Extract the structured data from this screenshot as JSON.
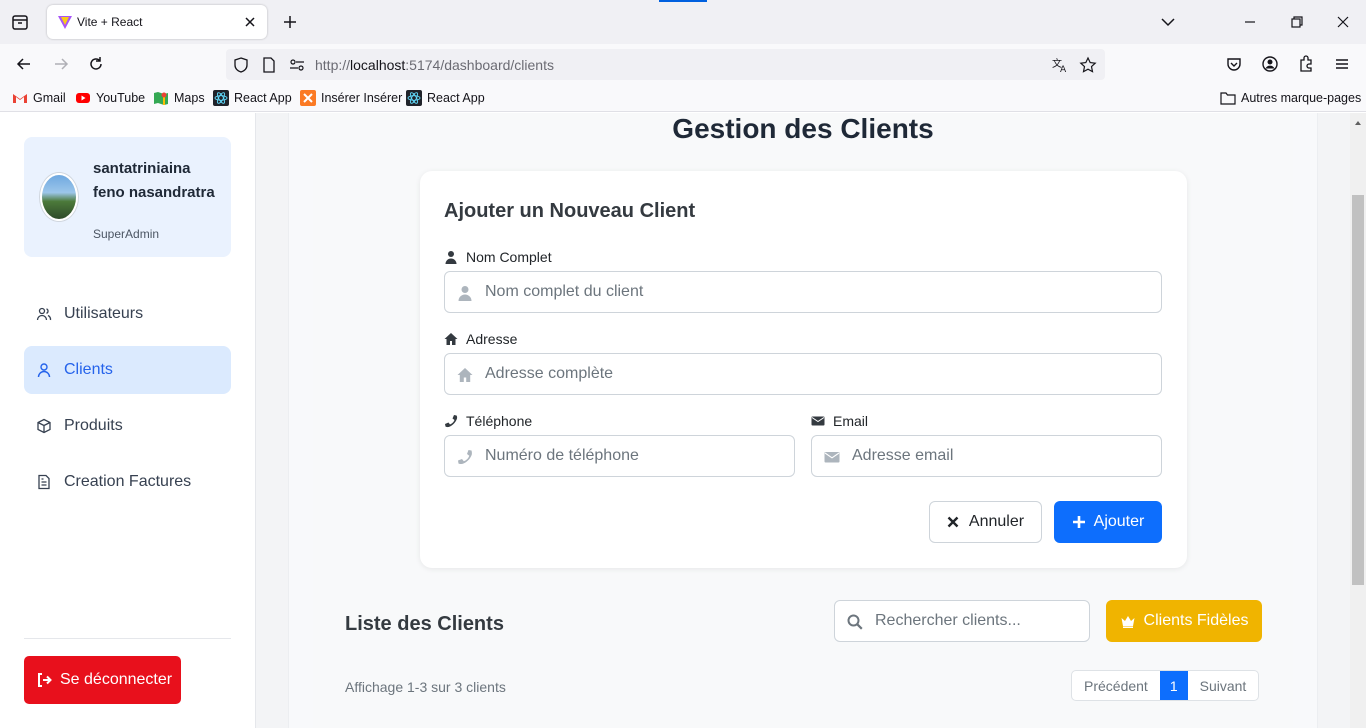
{
  "browser": {
    "tab_title": "Vite + React",
    "url_prefix": "http://",
    "url_host": "localhost",
    "url_rest": ":5174/dashboard/clients",
    "bookmarks": [
      "Gmail",
      "YouTube",
      "Maps",
      "React App",
      "Insérer Insérer",
      "React App"
    ],
    "other_bookmarks": "Autres marque-pages"
  },
  "sidebar": {
    "user_name": "santatriniaina feno nasandratra",
    "user_role": "SuperAdmin",
    "items": [
      {
        "label": "Utilisateurs"
      },
      {
        "label": "Clients"
      },
      {
        "label": "Produits"
      },
      {
        "label": "Creation Factures"
      }
    ],
    "logout_label": "Se déconnecter"
  },
  "main": {
    "page_title": "Gestion des Clients",
    "form": {
      "title": "Ajouter un Nouveau Client",
      "name_label": "Nom Complet",
      "name_placeholder": "Nom complet du client",
      "address_label": "Adresse",
      "address_placeholder": "Adresse complète",
      "phone_label": "Téléphone",
      "phone_placeholder": "Numéro de téléphone",
      "email_label": "Email",
      "email_placeholder": "Adresse email",
      "cancel_label": "Annuler",
      "add_label": "Ajouter"
    },
    "list": {
      "title": "Liste des Clients",
      "search_placeholder": "Rechercher clients...",
      "loyal_label": "Clients Fidèles",
      "showing": "Affichage 1-3 sur 3 clients",
      "prev_label": "Précédent",
      "current_page": "1",
      "next_label": "Suivant"
    }
  },
  "colors": {
    "primary": "#0d6efd",
    "danger": "#e8101c",
    "warning": "#f0b400",
    "active_bg": "#dbeafe"
  }
}
